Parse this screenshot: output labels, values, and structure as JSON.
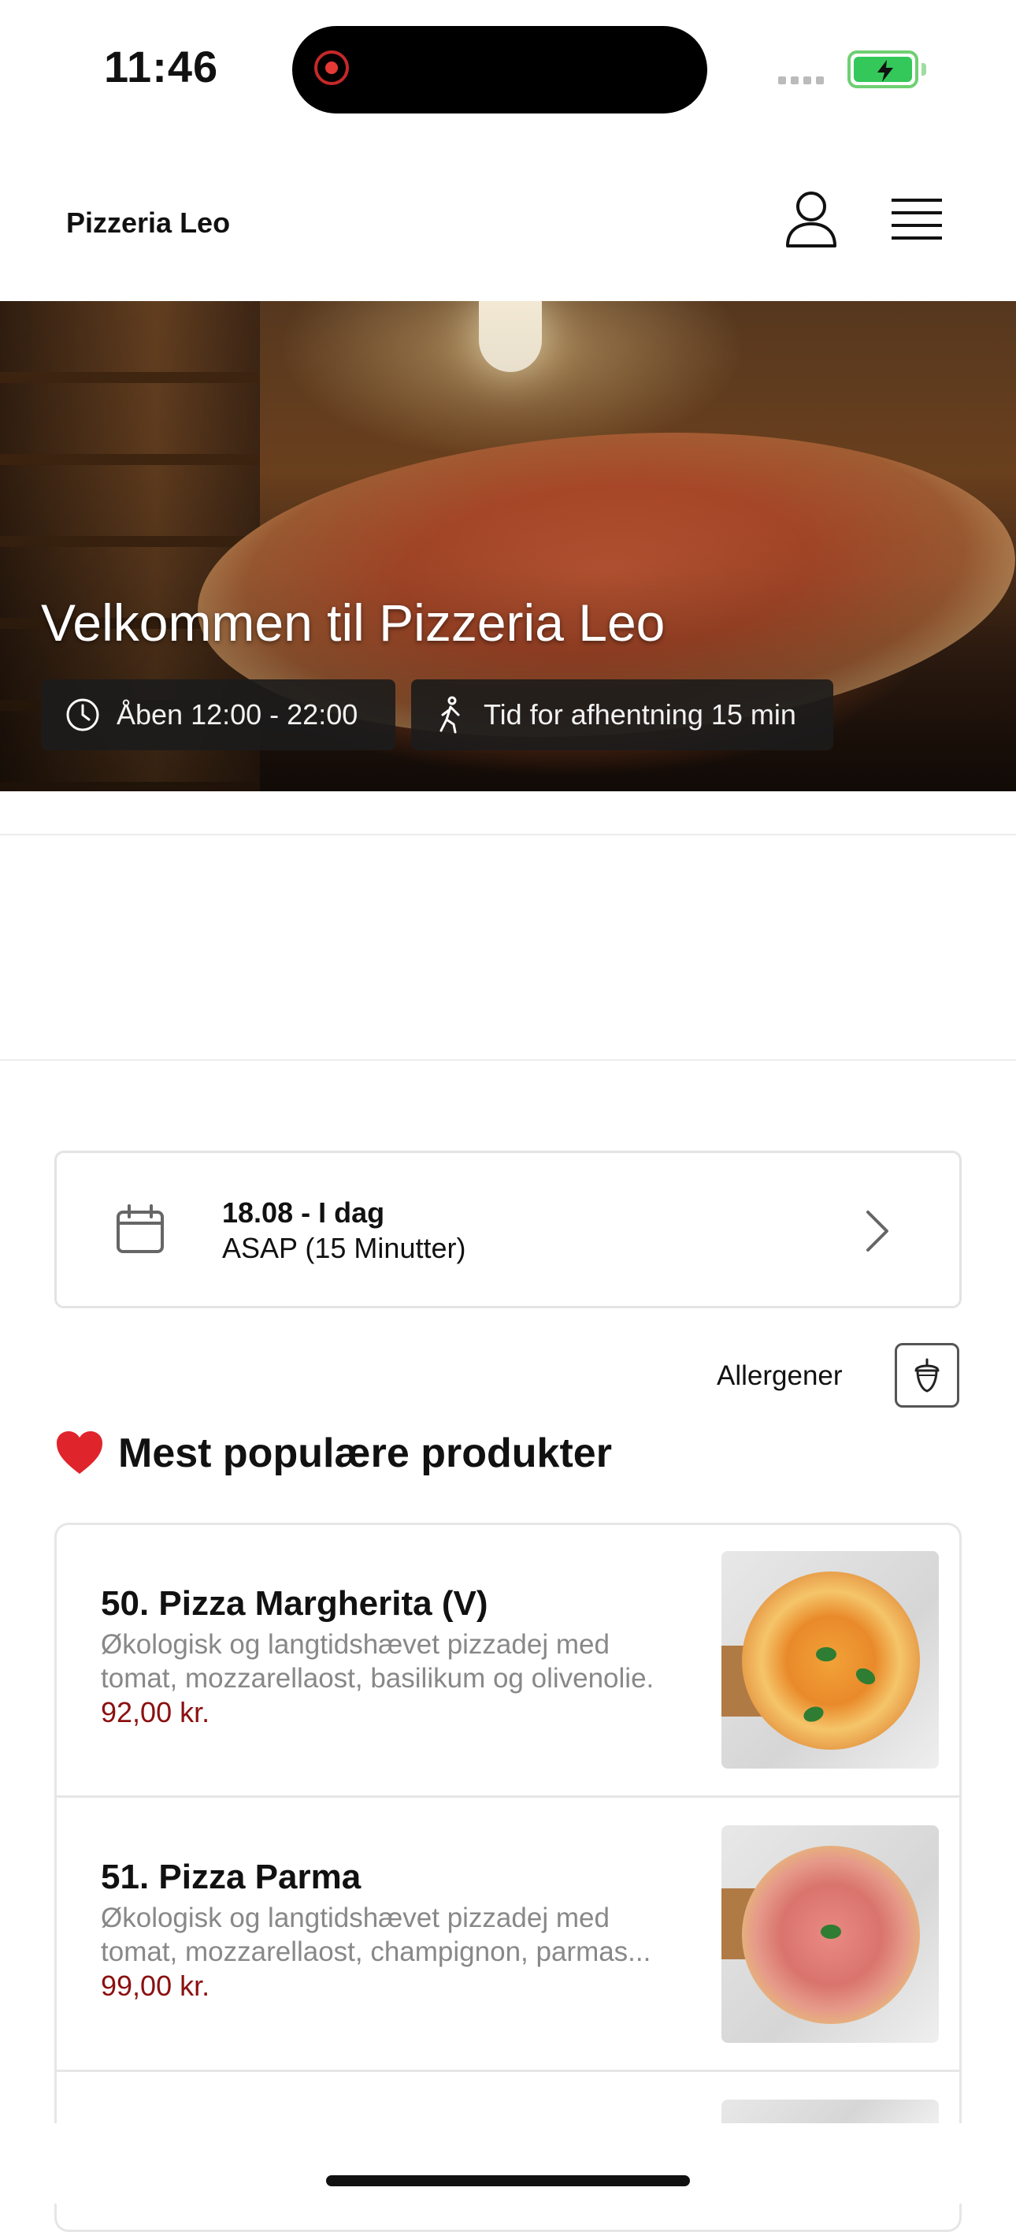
{
  "status_bar": {
    "time": "11:46"
  },
  "header": {
    "brand": "Pizzeria Leo"
  },
  "hero": {
    "title": "Velkommen til Pizzeria Leo",
    "open_hours": "Åben 12:00 - 22:00",
    "pickup_time": "Tid for afhentning 15 min"
  },
  "date_picker": {
    "date": "18.08 - I dag",
    "time": "ASAP (15 Minutter)"
  },
  "allergens": {
    "label": "Allergener"
  },
  "section": {
    "title": "Mest populære produkter"
  },
  "products": [
    {
      "name": "50. Pizza Margherita (V)",
      "desc_line1": "Økologisk og langtidshævet pizzadej med",
      "desc_line2": "tomat, mozzarellaost, basilikum og olivenolie.",
      "price": "92,00 kr."
    },
    {
      "name": "51. Pizza Parma",
      "desc_line1": "Økologisk og langtidshævet pizzadej med",
      "desc_line2": "tomat, mozzarellaost, champignon, parmas...",
      "price": "99,00 kr."
    }
  ],
  "colors": {
    "price": "#8b1010",
    "battery": "#34c759",
    "chip_bg": "#1c1c1c"
  }
}
